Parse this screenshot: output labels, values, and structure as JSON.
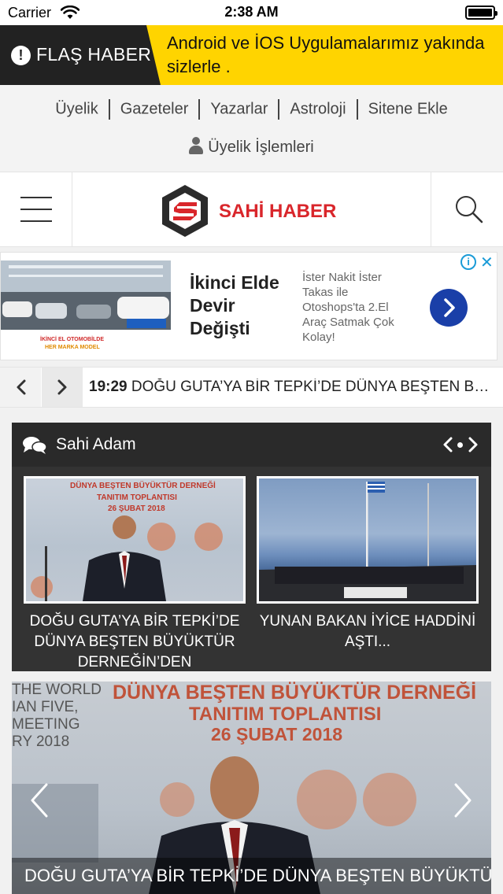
{
  "status_bar": {
    "carrier": "Carrier",
    "time": "2:38 AM"
  },
  "flash": {
    "label": "FLAŞ HABER",
    "message": "Android ve İOS Uygulamalarımız yakında sizlerle ."
  },
  "topnav": {
    "links": [
      "Üyelik",
      "Gazeteler",
      "Yazarlar",
      "Astroloji",
      "Sitene Ekle"
    ],
    "member": "Üyelik İşlemleri"
  },
  "header": {
    "brand_part1": "SAHİ",
    "brand_part2": "HABER"
  },
  "ad": {
    "title": "İkinci Elde Devir Değişti",
    "description": "İster Nakit İster Takas ile Otoshops'ta 2.El Araç Satmak Çok Kolay!",
    "image_line1": "İKİNCİ EL OTOMOBİLDE",
    "image_line2": "HER MARKA MODEL",
    "info": "i",
    "close": "✕"
  },
  "ticker": {
    "time": "19:29",
    "headline": "DOĞU GUTA’YA BİR TEPKİ’DE DÜNYA BEŞTEN BÜYÜKTÜR DERNEĞİN’DEN"
  },
  "widget": {
    "title": "Sahi Adam",
    "cards": [
      {
        "caption": "DOĞU GUTA’YA BİR TEPKİ’DE DÜNYA BEŞTEN BÜYÜKTÜR DERNEĞİN’DEN",
        "banner_line1": "DÜNYA BEŞTEN BÜYÜKTÜR DERNEĞİ",
        "banner_line2": "TANITIM TOPLANTISI",
        "banner_line3": "26 ŞUBAT 2018"
      },
      {
        "caption": "YUNAN BAKAN İYİCE HADDİNİ AŞTI..."
      }
    ]
  },
  "hero": {
    "banner_line1": "DÜNYA BEŞTEN BÜYÜKTÜR DERNEĞİ",
    "banner_line2": "TANITIM TOPLANTISI",
    "banner_line3": "26 ŞUBAT 2018",
    "side_line1": "THE WORLD",
    "side_line2": "IAN FIVE,",
    "side_line3": "MEETING",
    "side_line4": "RY 2018",
    "caption": "DOĞU GUTA’YA BİR TEPKİ’DE DÜNYA BEŞTEN BÜYÜKTÜR"
  },
  "colors": {
    "flash_bg": "#ffd400",
    "flash_label_bg": "#222222",
    "brand_red": "#d9262b",
    "ad_button": "#1a3fa8",
    "widget_bg": "#333333"
  }
}
